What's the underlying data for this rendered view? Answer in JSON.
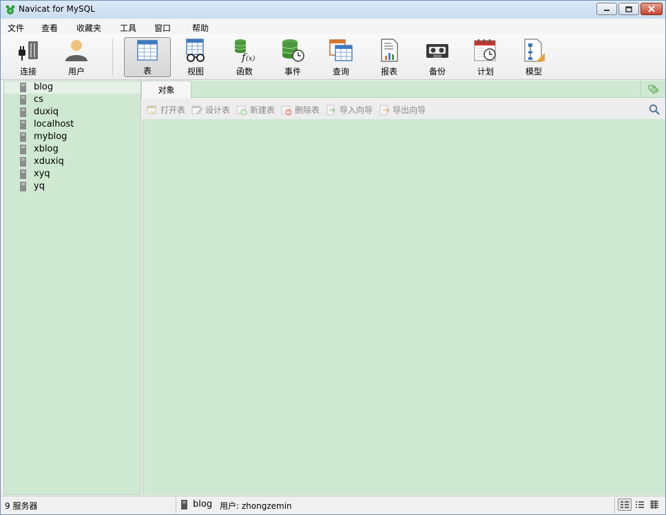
{
  "window": {
    "title": "Navicat for MySQL",
    "controls": [
      "minimize",
      "restore",
      "close"
    ]
  },
  "menu": {
    "items": [
      "文件",
      "查看",
      "收藏夹",
      "工具",
      "窗口",
      "帮助"
    ]
  },
  "toolbar": {
    "buttons": [
      {
        "label": "连接",
        "icon": "plug-icon"
      },
      {
        "label": "用户",
        "icon": "user-icon"
      },
      {
        "label": "表",
        "icon": "table-icon",
        "active": true
      },
      {
        "label": "视图",
        "icon": "view-glasses-icon"
      },
      {
        "label": "函数",
        "icon": "function-icon"
      },
      {
        "label": "事件",
        "icon": "event-clock-icon"
      },
      {
        "label": "查询",
        "icon": "query-icon"
      },
      {
        "label": "报表",
        "icon": "report-icon"
      },
      {
        "label": "备份",
        "icon": "backup-tape-icon"
      },
      {
        "label": "计划",
        "icon": "schedule-calendar-icon"
      },
      {
        "label": "模型",
        "icon": "model-icon"
      }
    ]
  },
  "sidebar": {
    "connections": [
      "blog",
      "cs",
      "duxiq",
      "localhost",
      "myblog",
      "xblog",
      "xduxiq",
      "xyq",
      "yq"
    ],
    "selected": "blog"
  },
  "main": {
    "tab": "对象",
    "object_toolbar": [
      "打开表",
      "设计表",
      "新建表",
      "删除表",
      "导入向导",
      "导出向导"
    ]
  },
  "status": {
    "count": "9 服务器",
    "database": "blog",
    "user": "用户: zhongzemin",
    "view_modes": [
      "list-view-icon",
      "detail-view-icon",
      "grid-view-icon"
    ]
  },
  "colors": {
    "panel_green": "#cfe8d2",
    "titlebar": "#dbe9f7",
    "close_red": "#c7432c"
  }
}
